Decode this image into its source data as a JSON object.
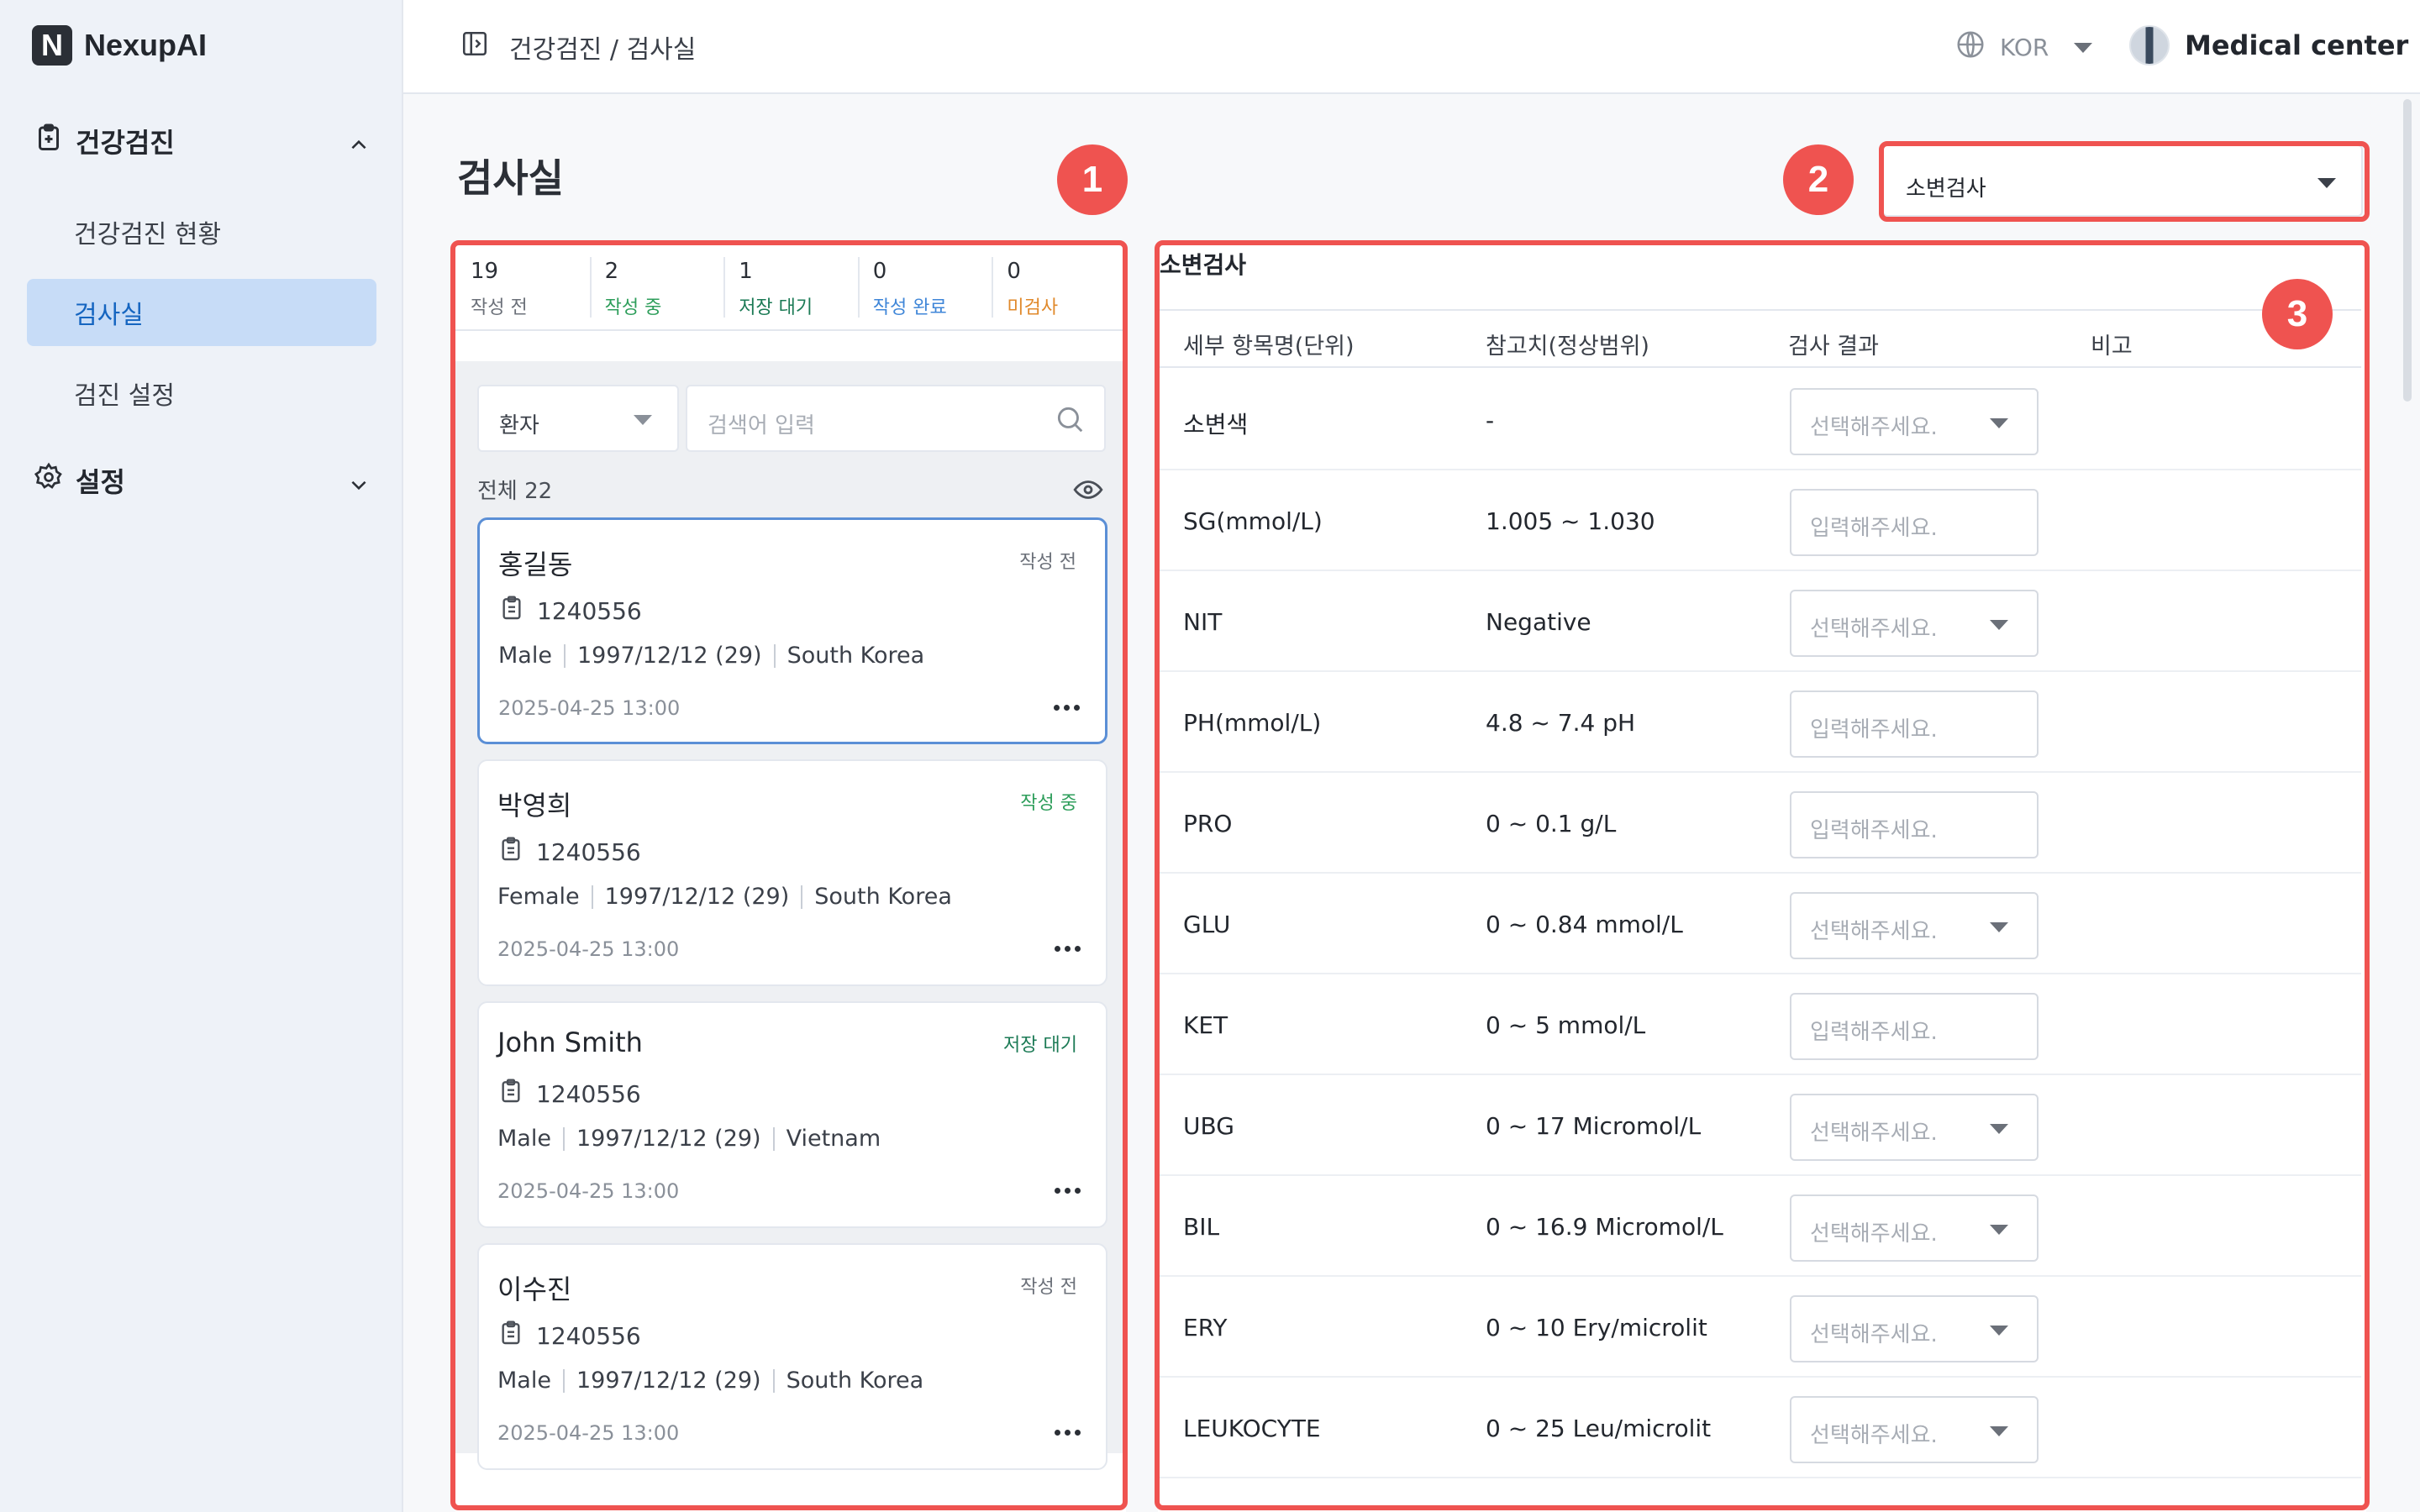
{
  "app": {
    "name": "NexupAI",
    "logo_letter": "N"
  },
  "sidebar": {
    "groups": [
      {
        "label": "건강검진",
        "icon": "clipboard-plus-icon",
        "expanded": true
      },
      {
        "label": "설정",
        "icon": "gear-icon",
        "expanded": false
      }
    ],
    "items": [
      {
        "label": "건강검진 현황",
        "active": false
      },
      {
        "label": "검사실",
        "active": true
      },
      {
        "label": "검진 설정",
        "active": false
      }
    ]
  },
  "header": {
    "breadcrumb": "건강검진 / 검사실",
    "language": "KOR",
    "user": "Medical center"
  },
  "page": {
    "title": "검사실"
  },
  "markers": [
    "1",
    "2",
    "3"
  ],
  "stats": [
    {
      "count": "19",
      "label": "작성 전",
      "color": "#6b7079"
    },
    {
      "count": "2",
      "label": "작성 중",
      "color": "#2e9e5b"
    },
    {
      "count": "1",
      "label": "저장 대기",
      "color": "#1b7a55"
    },
    {
      "count": "0",
      "label": "작성 완료",
      "color": "#3f86d8"
    },
    {
      "count": "0",
      "label": "미검사",
      "color": "#e0892b"
    }
  ],
  "filter": {
    "type": "환자",
    "search_placeholder": "검색어 입력",
    "total": "전체 22"
  },
  "patients": [
    {
      "name": "홍길동",
      "status": "작성 전",
      "id": "1240556",
      "gender": "Male",
      "dob": "1997/12/12 (29)",
      "country": "South Korea",
      "datetime": "2025-04-25 13:00"
    },
    {
      "name": "박영희",
      "status": "작성 중",
      "id": "1240556",
      "gender": "Female",
      "dob": "1997/12/12 (29)",
      "country": "South Korea",
      "datetime": "2025-04-25 13:00"
    },
    {
      "name": "John Smith",
      "status": "저장 대기",
      "id": "1240556",
      "gender": "Male",
      "dob": "1997/12/12 (29)",
      "country": "Vietnam",
      "datetime": "2025-04-25 13:00"
    },
    {
      "name": "이수진",
      "status": "작성 전",
      "id": "1240556",
      "gender": "Male",
      "dob": "1997/12/12 (29)",
      "country": "South Korea",
      "datetime": "2025-04-25 13:00"
    }
  ],
  "exam": {
    "selected": "소변검사",
    "title": "소변검사",
    "columns": [
      "세부 항목명(단위)",
      "참고치(정상범위)",
      "검사 결과",
      "비고"
    ],
    "select_placeholder": "선택해주세요.",
    "input_placeholder": "입력해주세요.",
    "rows": [
      {
        "item": "소변색",
        "ref": "-",
        "control": "select"
      },
      {
        "item": "SG(mmol/L)",
        "ref": "1.005 ~ 1.030",
        "control": "input"
      },
      {
        "item": "NIT",
        "ref": "Negative",
        "control": "select"
      },
      {
        "item": "PH(mmol/L)",
        "ref": "4.8 ~ 7.4 pH",
        "control": "input"
      },
      {
        "item": "PRO",
        "ref": "0 ~ 0.1 g/L",
        "control": "input"
      },
      {
        "item": "GLU",
        "ref": "0 ~ 0.84 mmol/L",
        "control": "select"
      },
      {
        "item": "KET",
        "ref": "0 ~ 5 mmol/L",
        "control": "input"
      },
      {
        "item": "UBG",
        "ref": "0 ~ 17 Micromol/L",
        "control": "select"
      },
      {
        "item": "BIL",
        "ref": "0 ~ 16.9 Micromol/L",
        "control": "select"
      },
      {
        "item": "ERY",
        "ref": "0 ~ 10 Ery/microlit",
        "control": "select"
      },
      {
        "item": "LEUKOCYTE",
        "ref": "0 ~ 25 Leu/microlit",
        "control": "select"
      }
    ]
  }
}
